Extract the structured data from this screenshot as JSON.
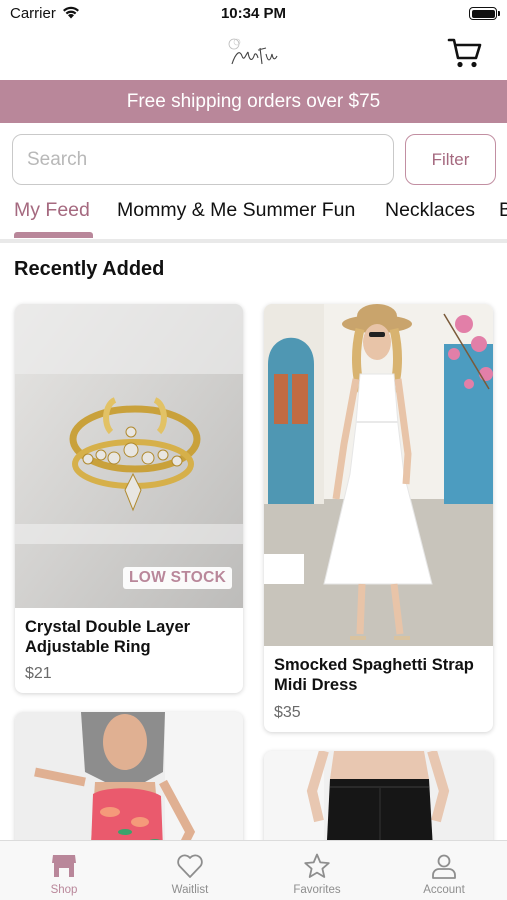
{
  "status_bar": {
    "carrier": "Carrier",
    "time": "10:34 PM"
  },
  "header": {
    "logo_text": "Yours Truly",
    "cart_icon": "cart-icon"
  },
  "promo_banner": {
    "text": "Free shipping orders over $75",
    "color": "#b9879a"
  },
  "search": {
    "placeholder": "Search",
    "value": "",
    "filter_label": "Filter"
  },
  "tabs": [
    {
      "label": "My Feed",
      "active": true
    },
    {
      "label": "Mommy & Me Summer Fun",
      "active": false
    },
    {
      "label": "Necklaces",
      "active": false
    },
    {
      "label": "B",
      "active": false
    }
  ],
  "section": {
    "title": "Recently Added"
  },
  "products": [
    {
      "name": "Crystal Double Layer Adjustable Ring",
      "price": "$21",
      "badge": "LOW STOCK"
    },
    {
      "name": "Smocked Spaghetti Strap Midi Dress",
      "price": "$35",
      "badge": ""
    },
    {
      "name": "",
      "price": "",
      "badge": ""
    },
    {
      "name": "",
      "price": "",
      "badge": ""
    }
  ],
  "bottom_nav": [
    {
      "label": "Shop",
      "icon": "shop-icon",
      "active": true
    },
    {
      "label": "Waitlist",
      "icon": "heart-icon",
      "active": false
    },
    {
      "label": "Favorites",
      "icon": "star-icon",
      "active": false
    },
    {
      "label": "Account",
      "icon": "account-icon",
      "active": false
    }
  ],
  "colors": {
    "accent": "#b9879a",
    "accent_text": "#a5697f",
    "text": "#111111",
    "muted": "#8e8e8e"
  }
}
